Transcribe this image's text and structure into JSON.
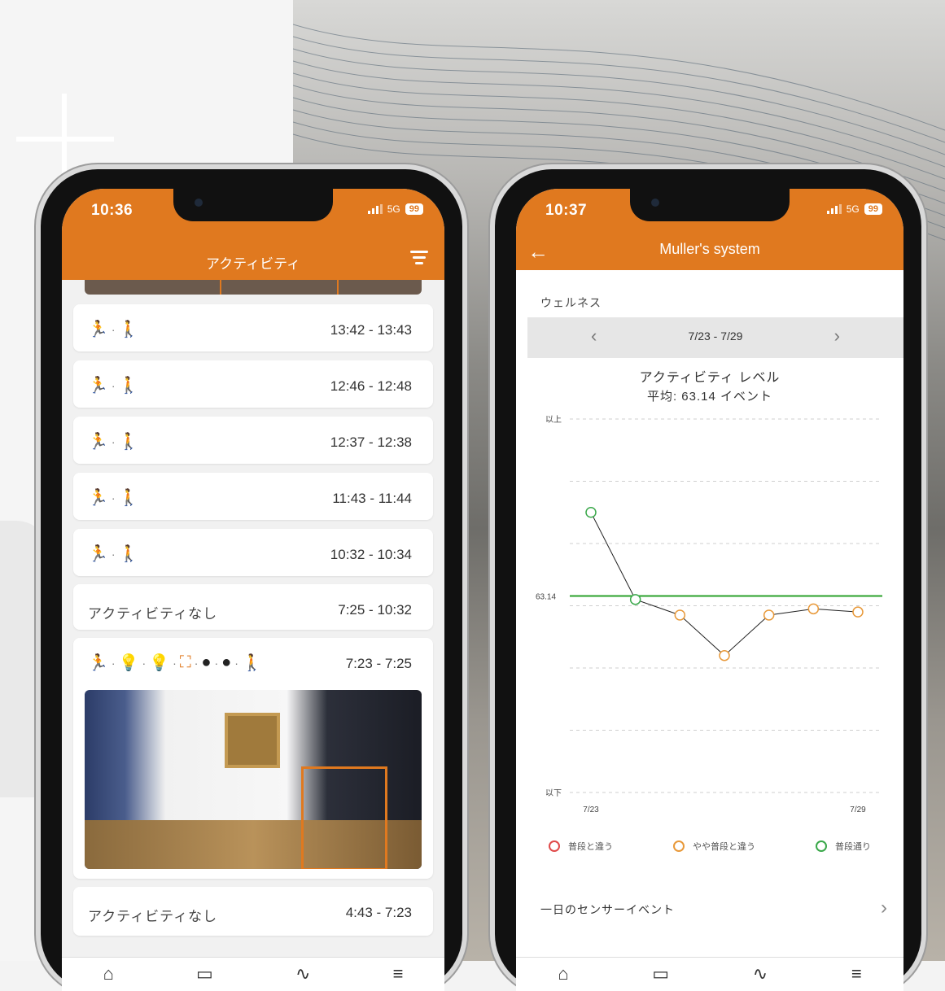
{
  "left_phone": {
    "time": "10:36",
    "network": "5G",
    "battery": "99",
    "title": "アクティビティ",
    "events": [
      {
        "time_range": "13:42 - 13:43"
      },
      {
        "time_range": "12:46 - 12:48"
      },
      {
        "time_range": "12:37 - 12:38"
      },
      {
        "time_range": "11:43 - 11:44"
      },
      {
        "time_range": "10:32 - 10:34"
      }
    ],
    "no_activity_1": {
      "label": "アクティビティなし",
      "time_range": "7:25 - 10:32"
    },
    "detailed_event": {
      "time_range": "7:23 - 7:25"
    },
    "no_activity_2": {
      "label": "アクティビティなし",
      "time_range": "4:43 - 7:23"
    }
  },
  "right_phone": {
    "time": "10:37",
    "network": "5G",
    "battery": "99",
    "title": "Muller's system",
    "section": "ウェルネス",
    "date_range": "7/23 - 7/29",
    "sensor_row_label": "一日のセンサーイベント"
  },
  "icons": {
    "motion": "motion-icon",
    "person": "person-icon",
    "bulb_on": "bulb-on-icon",
    "bulb_off": "bulb-off-icon",
    "presence": "presence-icon",
    "filter": "filter-icon",
    "back": "back-arrow-icon"
  },
  "colors": {
    "brand": "#e0791f",
    "average_line": "#2aa02a",
    "legend_red": "#e04a4a",
    "legend_orange": "#e8993a",
    "legend_green": "#3aa84a"
  },
  "chart_data": {
    "type": "line",
    "title": "アクティビティ レベル",
    "subtitle": "平均: 63.14 イベント",
    "x": [
      "7/23",
      "7/24",
      "7/25",
      "7/26",
      "7/27",
      "7/28",
      "7/29"
    ],
    "x_tick_labels": [
      "7/23",
      "7/29"
    ],
    "y_top_label": "以上",
    "y_bottom_label": "以下",
    "average": 63.14,
    "average_label": "63.14",
    "ylim": [
      0,
      120
    ],
    "series": [
      {
        "values": [
          90,
          62,
          57,
          44,
          57,
          59,
          58
        ],
        "statuses": [
          "green",
          "green",
          "orange",
          "orange",
          "orange",
          "orange",
          "orange"
        ]
      }
    ],
    "legend": [
      {
        "label": "普段と違う",
        "color": "#e04a4a"
      },
      {
        "label": "やや普段と違う",
        "color": "#e8993a"
      },
      {
        "label": "普段通り",
        "color": "#3aa84a"
      }
    ],
    "grid": true,
    "legend_position": "bottom"
  }
}
